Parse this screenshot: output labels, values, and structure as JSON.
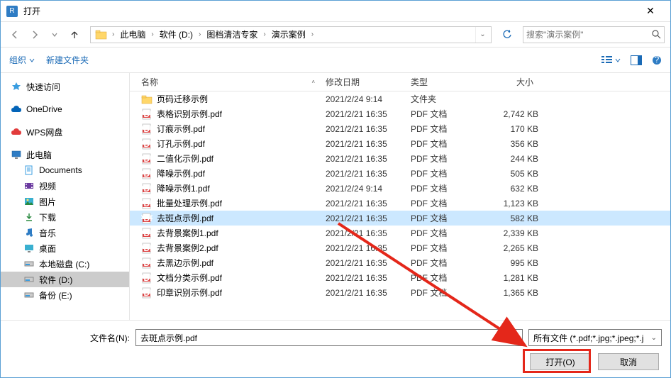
{
  "window": {
    "title": "打开"
  },
  "nav": {
    "breadcrumb": [
      "此电脑",
      "软件 (D:)",
      "图档清洁专家",
      "演示案例"
    ],
    "search_placeholder": "搜索\"演示案例\""
  },
  "toolbar": {
    "organize": "组织",
    "new_folder": "新建文件夹"
  },
  "sidebar": {
    "quick": "快速访问",
    "onedrive": "OneDrive",
    "wps": "WPS网盘",
    "this_pc": "此电脑",
    "documents": "Documents",
    "video": "视频",
    "pictures": "图片",
    "downloads": "下载",
    "music": "音乐",
    "desktop": "桌面",
    "disk_c": "本地磁盘 (C:)",
    "disk_d": "软件 (D:)",
    "disk_e": "备份 (E:)"
  },
  "columns": {
    "name": "名称",
    "date": "修改日期",
    "type": "类型",
    "size": "大小"
  },
  "files": [
    {
      "name": "页码迁移示例",
      "date": "2021/2/24 9:14",
      "type": "文件夹",
      "size": "",
      "kind": "folder"
    },
    {
      "name": "表格识别示例.pdf",
      "date": "2021/2/21 16:35",
      "type": "PDF 文档",
      "size": "2,742 KB",
      "kind": "pdf"
    },
    {
      "name": "订痕示例.pdf",
      "date": "2021/2/21 16:35",
      "type": "PDF 文档",
      "size": "170 KB",
      "kind": "pdf"
    },
    {
      "name": "订孔示例.pdf",
      "date": "2021/2/21 16:35",
      "type": "PDF 文档",
      "size": "356 KB",
      "kind": "pdf"
    },
    {
      "name": "二值化示例.pdf",
      "date": "2021/2/21 16:35",
      "type": "PDF 文档",
      "size": "244 KB",
      "kind": "pdf"
    },
    {
      "name": "降噪示例.pdf",
      "date": "2021/2/21 16:35",
      "type": "PDF 文档",
      "size": "505 KB",
      "kind": "pdf"
    },
    {
      "name": "降噪示例1.pdf",
      "date": "2021/2/24 9:14",
      "type": "PDF 文档",
      "size": "632 KB",
      "kind": "pdf"
    },
    {
      "name": "批量处理示例.pdf",
      "date": "2021/2/21 16:35",
      "type": "PDF 文档",
      "size": "1,123 KB",
      "kind": "pdf"
    },
    {
      "name": "去斑点示例.pdf",
      "date": "2021/2/21 16:35",
      "type": "PDF 文档",
      "size": "582 KB",
      "kind": "pdf",
      "selected": true
    },
    {
      "name": "去背景案例1.pdf",
      "date": "2021/2/21 16:35",
      "type": "PDF 文档",
      "size": "2,339 KB",
      "kind": "pdf"
    },
    {
      "name": "去背景案例2.pdf",
      "date": "2021/2/21 16:35",
      "type": "PDF 文档",
      "size": "2,265 KB",
      "kind": "pdf"
    },
    {
      "name": "去黑边示例.pdf",
      "date": "2021/2/21 16:35",
      "type": "PDF 文档",
      "size": "995 KB",
      "kind": "pdf"
    },
    {
      "name": "文档分类示例.pdf",
      "date": "2021/2/21 16:35",
      "type": "PDF 文档",
      "size": "1,281 KB",
      "kind": "pdf"
    },
    {
      "name": "印章识别示例.pdf",
      "date": "2021/2/21 16:35",
      "type": "PDF 文档",
      "size": "1,365 KB",
      "kind": "pdf"
    }
  ],
  "footer": {
    "filename_label": "文件名(N):",
    "filename_value": "去斑点示例.pdf",
    "filter": "所有文件 (*.pdf;*.jpg;*.jpeg;*.j",
    "open": "打开(O)",
    "cancel": "取消"
  }
}
